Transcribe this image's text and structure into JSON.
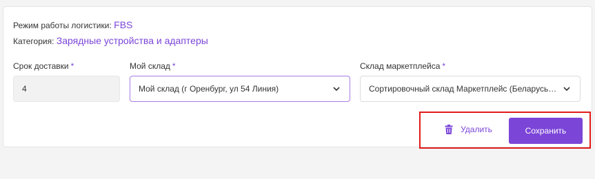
{
  "header": {
    "mode_label": "Режим работы логистики:",
    "mode_value": "FBS",
    "category_label": "Категория:",
    "category_value": "Зарядные устройства и адаптеры"
  },
  "fields": {
    "delivery_days": {
      "label": "Срок доставки",
      "required_mark": "*",
      "value": "4"
    },
    "my_warehouse": {
      "label": "Мой склад",
      "required_mark": "*",
      "selected": "Мой склад (г Оренбург, ул 54 Линия)",
      "icon": "chevron-down-icon"
    },
    "marketplace_warehouse": {
      "label": "Склад маркетплейса",
      "required_mark": "*",
      "selected": "Сортировочный склад Маркетплейс (Беларусь, Брест)",
      "icon": "chevron-down-icon"
    }
  },
  "actions": {
    "delete_label": "Удалить",
    "delete_icon": "trash-icon",
    "save_label": "Сохранить"
  },
  "colors": {
    "accent": "#7b45d8",
    "highlight": "#e11919",
    "background": "#f4f4f4"
  }
}
